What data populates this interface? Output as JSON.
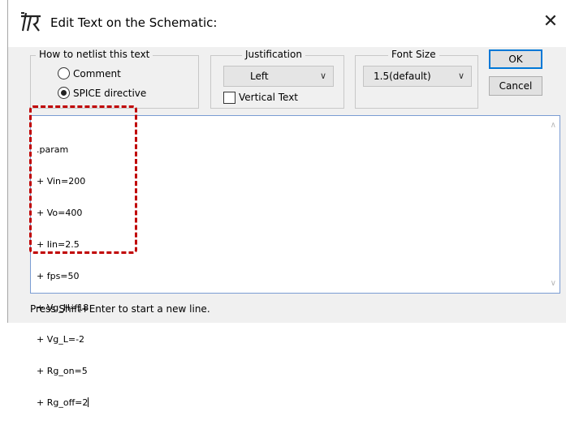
{
  "window": {
    "title": "Edit Text on the Schematic:",
    "close_glyph": "✕",
    "title_icon": "schematic-text-icon"
  },
  "netlist_group": {
    "legend": "How to netlist this text",
    "options": [
      {
        "label": "Comment",
        "selected": false
      },
      {
        "label": "SPICE directive",
        "selected": true
      }
    ]
  },
  "justification": {
    "legend": "Justification",
    "selected": "Left",
    "vertical_text_label": "Vertical Text",
    "vertical_text_checked": false
  },
  "font_size": {
    "legend": "Font Size",
    "selected": "1.5(default)"
  },
  "buttons": {
    "ok": "OK",
    "cancel": "Cancel"
  },
  "editor": {
    "lines": [
      ".param",
      "+ Vin=200",
      "+ Vo=400",
      "+ Iin=2.5",
      "+ fps=50",
      "+ Vg_H=18",
      "+ Vg_L=-2",
      "+ Rg_on=5",
      "+ Rg_off=2"
    ]
  },
  "status": "Press Shift+Enter to start a new line.",
  "colors": {
    "highlight": "#c00000",
    "default_button_border": "#0078d7"
  }
}
